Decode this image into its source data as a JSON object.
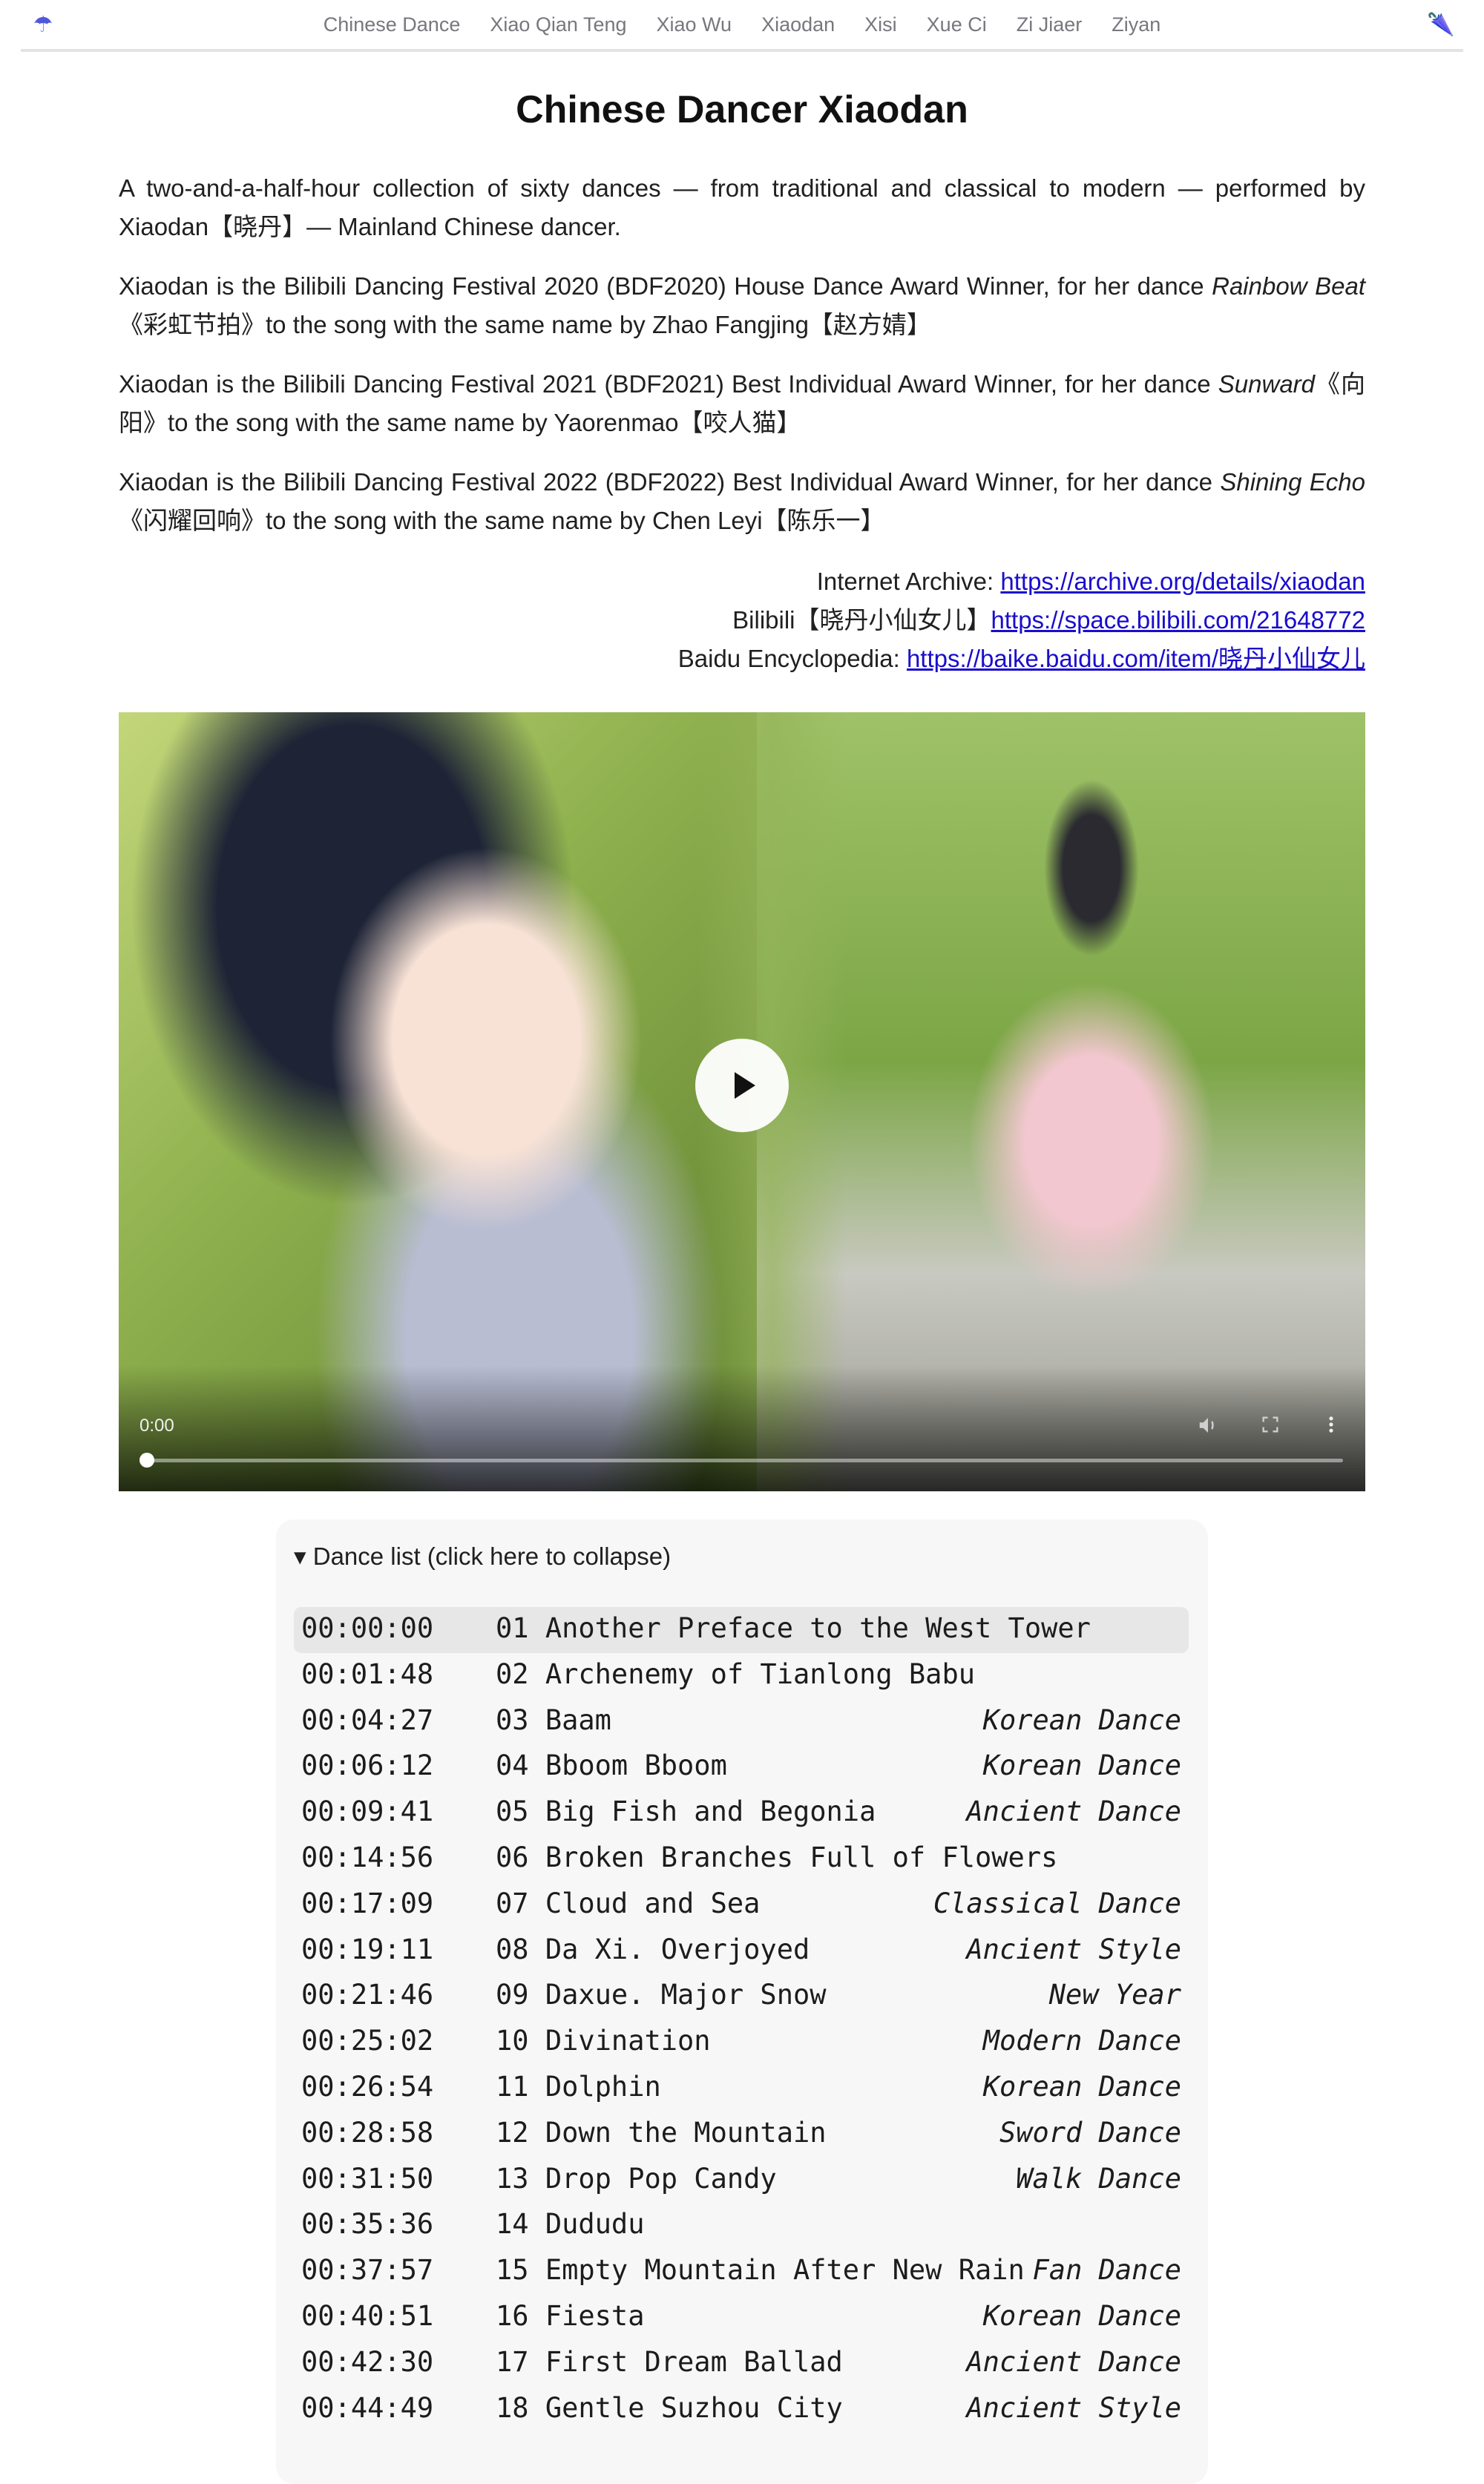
{
  "nav": {
    "links": [
      "Chinese Dance",
      "Xiao Qian Teng",
      "Xiao Wu",
      "Xiaodan",
      "Xisi",
      "Xue Ci",
      "Zi Jiaer",
      "Ziyan"
    ],
    "left_icon": "umbrella-icon",
    "right_icon": "closed-umbrella-icon"
  },
  "page": {
    "title": "Chinese Dancer Xiaodan",
    "intro": [
      {
        "text": "A two-and-a-half-hour collection of sixty dances — from traditional and classical to modern — performed by Xiaodan【晓丹】— Mainland Chinese dancer."
      },
      {
        "pre": "Xiaodan is the Bilibili Dancing Festival 2020 (BDF2020) House Dance Award Winner, for her dance ",
        "em": "Rainbow Beat",
        "post": "《彩虹节拍》to the song with the same name by Zhao Fangjing【赵方婧】"
      },
      {
        "pre": "Xiaodan is the Bilibili Dancing Festival 2021 (BDF2021) Best Individual Award Winner, for her dance ",
        "em": "Sunward",
        "post": "《向阳》to the song with the same name by Yaorenmao【咬人猫】"
      },
      {
        "pre": "Xiaodan is the Bilibili Dancing Festival 2022 (BDF2022) Best Individual Award Winner, for her dance ",
        "em": "Shining Echo",
        "post": "《闪耀回响》to the song with the same name by Chen Leyi【陈乐一】"
      }
    ],
    "links": [
      {
        "label": "Internet Archive: ",
        "url": "https://archive.org/details/xiaodan"
      },
      {
        "label": "Bilibili【晓丹小仙女儿】",
        "url": "https://space.bilibili.com/21648772"
      },
      {
        "label": "Baidu Encyclopedia: ",
        "url": "https://baike.baidu.com/item/晓丹小仙女儿"
      }
    ]
  },
  "video": {
    "current_time": "0:00",
    "progress": 0,
    "play_icon": "play-icon",
    "mute_icon": "volume-icon",
    "fullscreen_icon": "fullscreen-icon",
    "menu_icon": "more-vertical-icon"
  },
  "dance_list": {
    "summary": "▾ Dance list (click here to collapse)",
    "items": [
      {
        "time": "00:00:00",
        "title": "01 Another Preface to the West Tower",
        "style": ""
      },
      {
        "time": "00:01:48",
        "title": "02 Archenemy of Tianlong Babu",
        "style": ""
      },
      {
        "time": "00:04:27",
        "title": "03 Baam",
        "style": "Korean Dance"
      },
      {
        "time": "00:06:12",
        "title": "04 Bboom Bboom",
        "style": "Korean Dance"
      },
      {
        "time": "00:09:41",
        "title": "05 Big Fish and Begonia",
        "style": "Ancient Dance"
      },
      {
        "time": "00:14:56",
        "title": "06 Broken Branches Full of Flowers",
        "style": ""
      },
      {
        "time": "00:17:09",
        "title": "07 Cloud and Sea",
        "style": "Classical Dance"
      },
      {
        "time": "00:19:11",
        "title": "08 Da Xi. Overjoyed",
        "style": "Ancient Style"
      },
      {
        "time": "00:21:46",
        "title": "09 Daxue. Major Snow",
        "style": "New Year"
      },
      {
        "time": "00:25:02",
        "title": "10 Divination",
        "style": "Modern Dance"
      },
      {
        "time": "00:26:54",
        "title": "11 Dolphin",
        "style": "Korean Dance"
      },
      {
        "time": "00:28:58",
        "title": "12 Down the Mountain",
        "style": "Sword Dance"
      },
      {
        "time": "00:31:50",
        "title": "13 Drop Pop Candy",
        "style": "Walk Dance"
      },
      {
        "time": "00:35:36",
        "title": "14 Dududu",
        "style": ""
      },
      {
        "time": "00:37:57",
        "title": "15 Empty Mountain After New Rain",
        "style": "Fan Dance"
      },
      {
        "time": "00:40:51",
        "title": "16 Fiesta",
        "style": "Korean Dance"
      },
      {
        "time": "00:42:30",
        "title": "17 First Dream Ballad",
        "style": "Ancient Dance"
      },
      {
        "time": "00:44:49",
        "title": "18 Gentle Suzhou City",
        "style": "Ancient Style"
      }
    ]
  },
  "colors": {
    "accent": "#5058d8",
    "link": "#1a0dcc",
    "nav_text": "#77777d",
    "list_bg": "#f7f7f7",
    "selected_row": "#e7e7e7"
  }
}
